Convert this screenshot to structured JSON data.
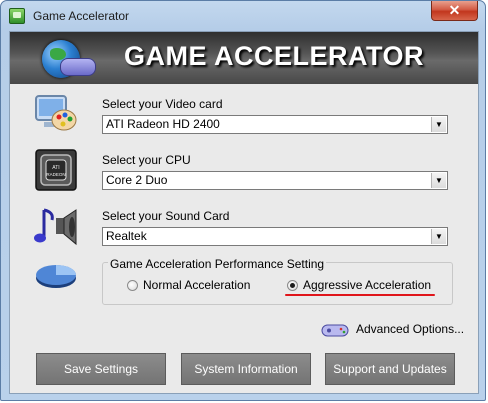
{
  "window": {
    "title": "Game Accelerator",
    "close_label": "✕"
  },
  "banner": {
    "title": "GAME ACCELERATOR"
  },
  "video": {
    "label": "Select your Video card",
    "value": "ATI Radeon HD 2400",
    "icon": "monitor-palette-icon"
  },
  "cpu": {
    "label": "Select your CPU",
    "value": "Core 2 Duo",
    "icon": "cpu-chip-icon",
    "chip_text": "ATI\nRADEON"
  },
  "sound": {
    "label": "Select your Sound Card",
    "value": "Realtek",
    "icon": "speaker-note-icon"
  },
  "performance": {
    "title": "Game Acceleration Performance Setting",
    "options": [
      {
        "label": "Normal Acceleration",
        "checked": false
      },
      {
        "label": "Aggressive Acceleration",
        "checked": true
      }
    ]
  },
  "advanced": {
    "label": "Advanced Options..."
  },
  "buttons": {
    "save": "Save Settings",
    "system": "System Information",
    "support": "Support and Updates"
  },
  "colors": {
    "banner_bg": "#4b4b4b",
    "client_bg": "#eaeaea",
    "button_bg": "#7f7f7f",
    "annotation_red": "#e0151b"
  }
}
